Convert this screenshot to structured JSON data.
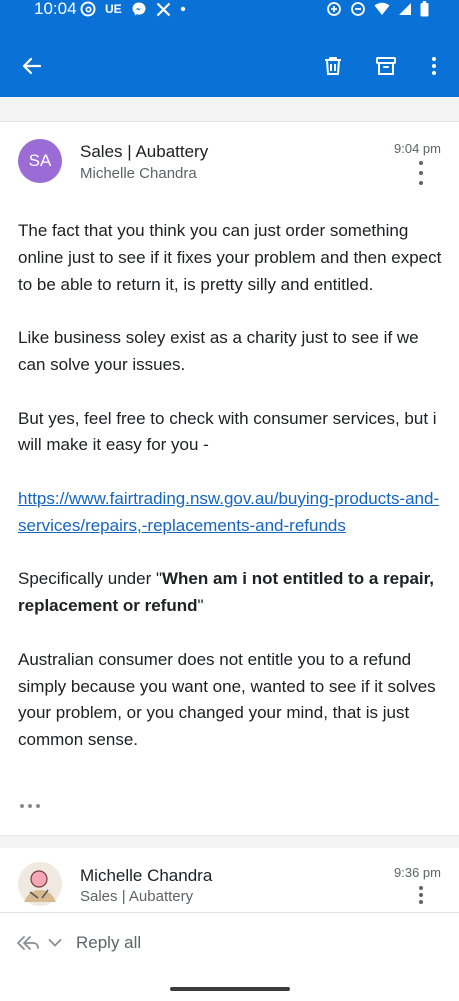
{
  "status_bar": {
    "time": "10:04",
    "left_icons": [
      "threads-icon",
      "ue-text",
      "messenger-icon",
      "x-icon",
      "dot-icon"
    ],
    "ue_label": "UE",
    "right_icons": [
      "data-saver-icon",
      "do-not-disturb-icon",
      "wifi-icon",
      "signal-icon",
      "battery-icon"
    ]
  },
  "app_bar": {
    "back_icon": "arrow-left-icon",
    "delete_icon": "trash-icon",
    "archive_icon": "archive-icon",
    "more_icon": "more-vert-icon",
    "background": "#0a72d6"
  },
  "message1": {
    "avatar_initials": "SA",
    "avatar_color": "#9b6bd6",
    "sender": "Sales | Aubattery",
    "recipient": "Michelle Chandra",
    "time": "9:04 pm",
    "para1": "The fact that you think you can just order something online just to see if it fixes your problem and then expect to be able to return it, is pretty silly and entitled.",
    "para2": "Like business soley exist as a charity just to see if we can solve your issues.",
    "para3": "But yes, feel free to check with consumer services, but i will make it easy for you -",
    "link": "https://www.fairtrading.nsw.gov.au/buying-products-and-services/repairs,-replacements-and-refunds",
    "para5_prefix": "Specifically under \"",
    "para5_bold": "When am i not entitled to a repair, replacement or refund",
    "para5_suffix": "\"",
    "para6": "Australian consumer does not entitle you to a refund simply because you want one, wanted to see if it solves your problem, or you changed your mind, that is just common sense."
  },
  "message2": {
    "sender": "Michelle Chandra",
    "recipient": "Sales | Aubattery",
    "time": "9:36 pm"
  },
  "bottom_bar": {
    "reply_label": "Reply all",
    "reply_icon": "reply-all-icon",
    "chevron_icon": "chevron-down-icon"
  }
}
